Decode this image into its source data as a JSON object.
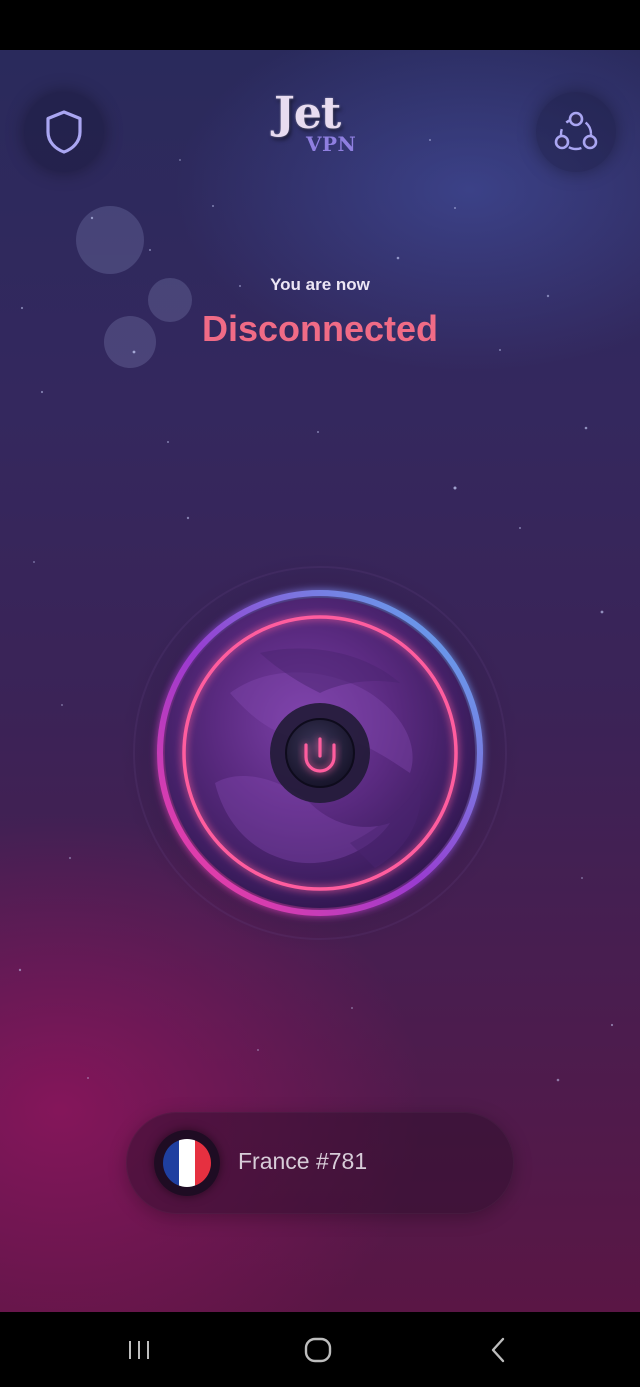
{
  "app": {
    "logo_main": "Jet",
    "logo_sub": "VPN"
  },
  "status": {
    "subtitle": "You are now",
    "state": "Disconnected",
    "state_color": "#f06b86"
  },
  "server": {
    "name": "France #781",
    "flag": "france-flag",
    "flag_colors": [
      "#1f3fa0",
      "#ffffff",
      "#e63040"
    ]
  },
  "icons": {
    "top_left": "shield-icon",
    "top_right": "share-icon",
    "center": "power-icon",
    "nav": [
      "recent-apps-icon",
      "home-icon",
      "back-icon"
    ]
  },
  "colors": {
    "accent_pink": "#ff3d8a",
    "accent_blue": "#5aa8f0"
  }
}
